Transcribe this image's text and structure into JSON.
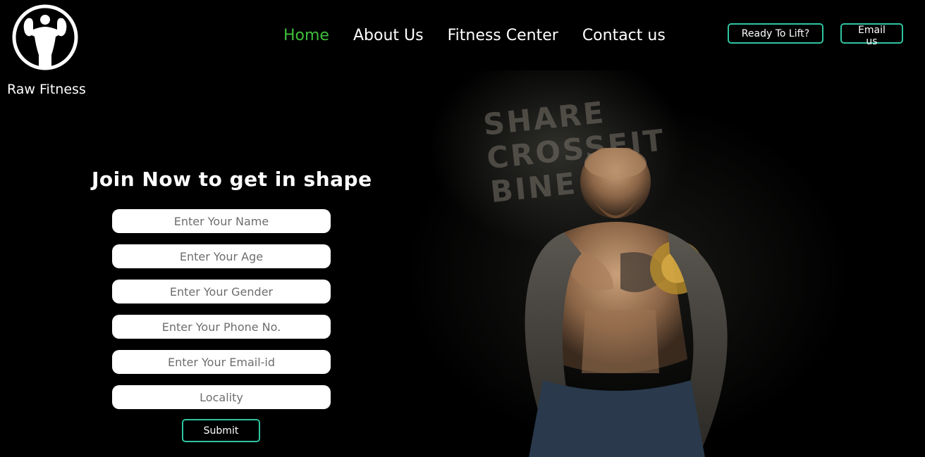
{
  "brand": {
    "name": "Raw Fitness"
  },
  "nav": {
    "items": [
      {
        "label": "Home",
        "active": true
      },
      {
        "label": "About Us",
        "active": false
      },
      {
        "label": "Fitness Center",
        "active": false
      },
      {
        "label": "Contact us",
        "active": false
      }
    ]
  },
  "header_buttons": {
    "ready_label": "Ready To Lift?",
    "email_label": "Email us"
  },
  "form": {
    "title": "Join Now to get in shape",
    "fields": [
      {
        "placeholder": "Enter Your Name"
      },
      {
        "placeholder": "Enter Your Age"
      },
      {
        "placeholder": "Enter Your Gender"
      },
      {
        "placeholder": "Enter Your Phone No."
      },
      {
        "placeholder": "Enter Your Email-id"
      },
      {
        "placeholder": "Locality"
      }
    ],
    "submit_label": "Submit"
  },
  "hero": {
    "banner_text": "SHARE CROSSFIT BINE"
  },
  "colors": {
    "accent_active": "#3fbf3a",
    "button_border": "#2fc4a0",
    "background": "#000000"
  },
  "icons": {
    "logo": "bodybuilder-flexing-icon"
  }
}
